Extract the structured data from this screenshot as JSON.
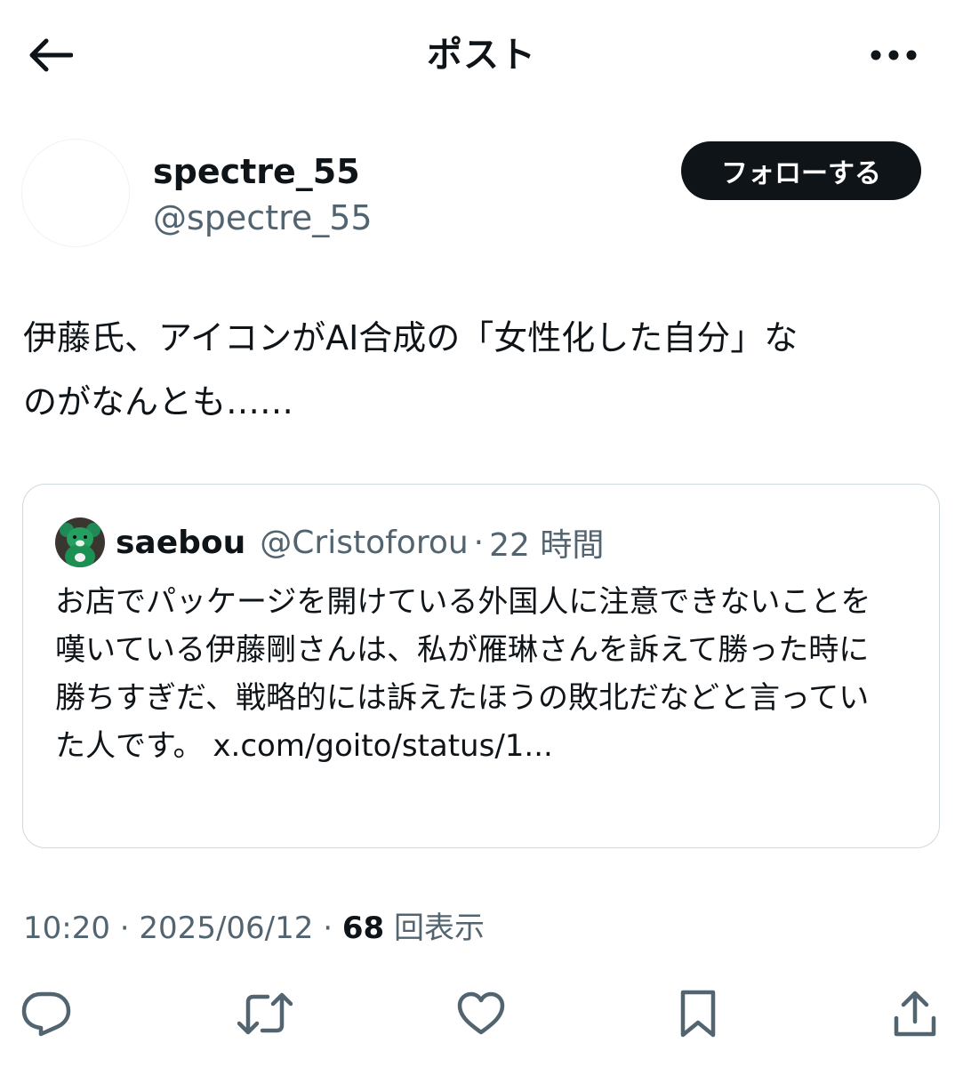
{
  "header": {
    "title": "ポスト"
  },
  "author": {
    "display_name": "spectre_55",
    "handle": "@spectre_55",
    "follow_label": "フォローする"
  },
  "post": {
    "text": "伊藤氏、アイコンがAI合成の「女性化した自分」な\nのがなんとも……"
  },
  "quote": {
    "display_name": "saebou",
    "handle": "@Cristoforou",
    "separator": "·",
    "time": "22 時間",
    "text": "お店でパッケージを開けている外国人に注意できないことを嘆いている伊藤剛さんは、私が雁琳さんを訴えて勝った時に勝ちすぎだ、戦略的には訴えたほうの敗北だなどと言っていた人です。 ",
    "link": "x.com/goito/status/1..."
  },
  "meta": {
    "time": "10:20",
    "sep1": " · ",
    "date": "2025/06/12",
    "sep2": " · ",
    "views_count": "68",
    "views_label": " 回表示"
  },
  "icons": {
    "back": "arrow-left-icon",
    "more": "more-horizontal-icon",
    "reply": "reply-icon",
    "retweet": "retweet-icon",
    "like": "heart-icon",
    "bookmark": "bookmark-icon",
    "share": "share-icon"
  },
  "colors": {
    "text_primary": "#0f1419",
    "text_secondary": "#536471",
    "border": "#cfd9de",
    "follow_bg": "#0f1419"
  }
}
